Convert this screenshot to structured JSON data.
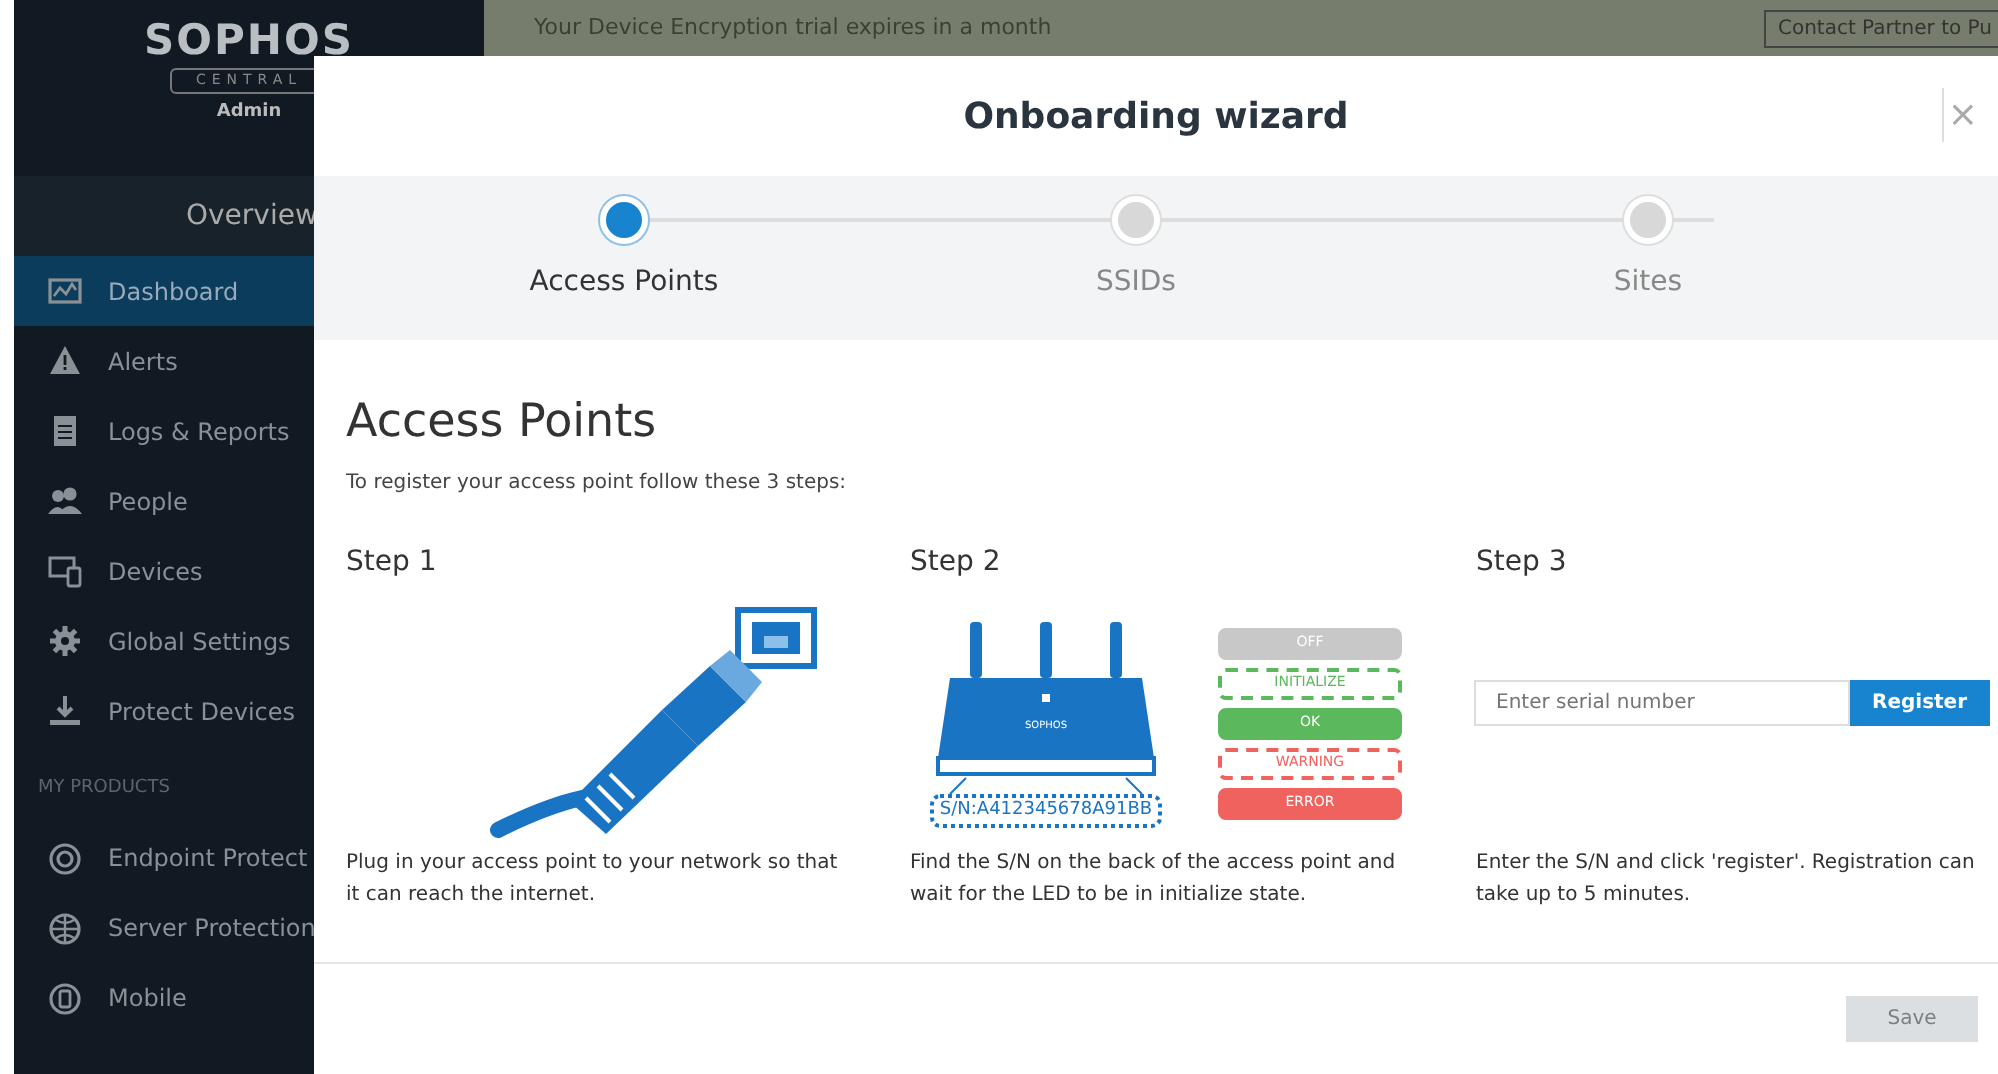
{
  "logo": {
    "brand": "SOPHOS",
    "product": "CENTRAL",
    "role": "Admin"
  },
  "sidebar": {
    "section_title": "Overview",
    "items": [
      {
        "label": "Dashboard",
        "selected": true
      },
      {
        "label": "Alerts",
        "selected": false
      },
      {
        "label": "Logs & Reports",
        "selected": false
      },
      {
        "label": "People",
        "selected": false
      },
      {
        "label": "Devices",
        "selected": false
      },
      {
        "label": "Global Settings",
        "selected": false
      },
      {
        "label": "Protect Devices",
        "selected": false
      }
    ],
    "products_heading": "MY PRODUCTS",
    "products": [
      {
        "label": "Endpoint Protect"
      },
      {
        "label": "Server Protection"
      },
      {
        "label": "Mobile"
      }
    ]
  },
  "banner": {
    "text": "Your Device Encryption trial expires in a month",
    "button": "Contact Partner to Pu"
  },
  "modal": {
    "title": "Onboarding wizard",
    "close": "×",
    "steps": [
      {
        "label": "Access Points",
        "selected": true
      },
      {
        "label": "SSIDs",
        "selected": false
      },
      {
        "label": "Sites",
        "selected": false
      }
    ],
    "heading": "Access Points",
    "intro": "To register your access point follow these 3 steps:",
    "columns": [
      {
        "kind": "cable",
        "title": "Step 1",
        "text": "Plug in your access point to your network so that it can reach the internet."
      },
      {
        "kind": "router",
        "title": "Step 2",
        "text": "Find the S/N on the back of the access point and wait for the LED to be in initialize state.",
        "router_label": "SOPHOS",
        "serial": "S/N:A412345678A91BB",
        "leds": [
          {
            "label": "OFF",
            "kind": "solid",
            "color": "#c8c8c8"
          },
          {
            "label": "INITIALIZE",
            "kind": "dashed",
            "color": "#5cb85c"
          },
          {
            "label": "OK",
            "kind": "solid",
            "color": "#5cb85c"
          },
          {
            "label": "WARNING",
            "kind": "dashed",
            "color": "#f0625d"
          },
          {
            "label": "ERROR",
            "kind": "solid",
            "color": "#f0625d"
          }
        ]
      },
      {
        "kind": "register",
        "title": "Step 3",
        "placeholder": "Enter serial number",
        "button": "Register",
        "text": "Enter the S/N and click 'register'. Registration can take up to 5 minutes."
      }
    ],
    "save": {
      "label": "Save",
      "disabled": true
    }
  }
}
